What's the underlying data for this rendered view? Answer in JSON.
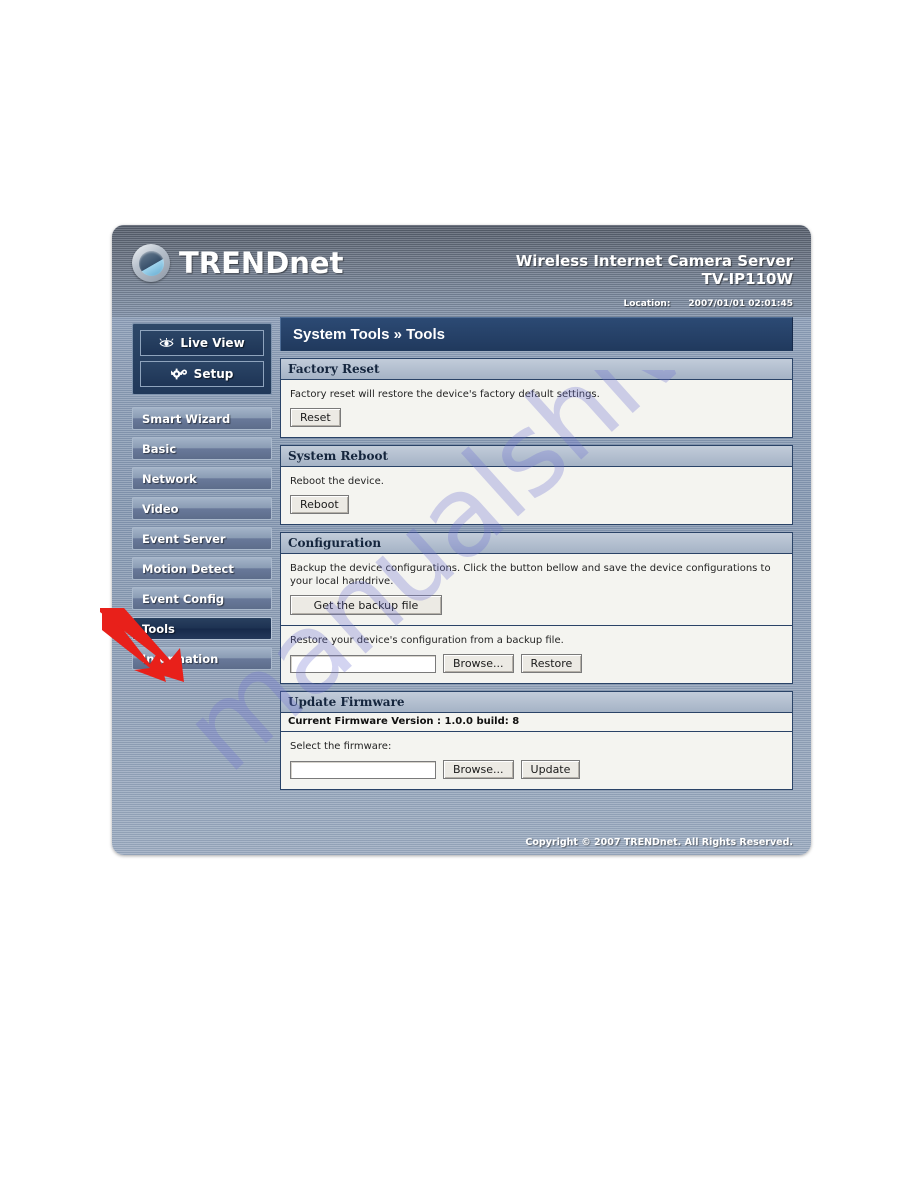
{
  "watermark": {
    "text": "manualshive.com"
  },
  "header": {
    "brand": "TRENDnet",
    "brand_upper": "TRENDn",
    "product_name": "Wireless Internet Camera Server",
    "product_model": "TV-IP110W",
    "location_label": "Location:",
    "datetime": "2007/01/01 02:01:45"
  },
  "sidebar": {
    "top_buttons": [
      {
        "label": "Live View",
        "icon": "eye-icon"
      },
      {
        "label": "Setup",
        "icon": "gear-icon"
      }
    ],
    "items": [
      {
        "label": "Smart Wizard",
        "active": false
      },
      {
        "label": "Basic",
        "active": false
      },
      {
        "label": "Network",
        "active": false
      },
      {
        "label": "Video",
        "active": false
      },
      {
        "label": "Event Server",
        "active": false
      },
      {
        "label": "Motion Detect",
        "active": false
      },
      {
        "label": "Event Config",
        "active": false
      },
      {
        "label": "Tools",
        "active": true
      },
      {
        "label": "Information",
        "active": false
      }
    ]
  },
  "panel": {
    "title": "System Tools » Tools",
    "sections": {
      "factory_reset": {
        "heading": "Factory Reset",
        "description": "Factory reset will restore the device's factory default settings.",
        "button": "Reset"
      },
      "system_reboot": {
        "heading": "System Reboot",
        "description": "Reboot the device.",
        "button": "Reboot"
      },
      "configuration": {
        "heading": "Configuration",
        "backup_description": "Backup the device configurations. Click the button bellow and save the device configurations to your local harddrive.",
        "backup_button": "Get the backup file",
        "restore_description": "Restore your device's configuration from a backup file.",
        "restore_field_value": "",
        "browse_button": "Browse...",
        "restore_button": "Restore"
      },
      "update_firmware": {
        "heading": "Update Firmware",
        "current_version": "Current Firmware Version : 1.0.0 build: 8",
        "select_label": "Select the firmware:",
        "firmware_field_value": "",
        "browse_button": "Browse...",
        "update_button": "Update"
      }
    }
  },
  "footer": {
    "copyright": "Copyright © 2007 TRENDnet. All Rights Reserved."
  },
  "annotation": {
    "arrow_color": "#e8201a",
    "points_to": "Tools"
  }
}
